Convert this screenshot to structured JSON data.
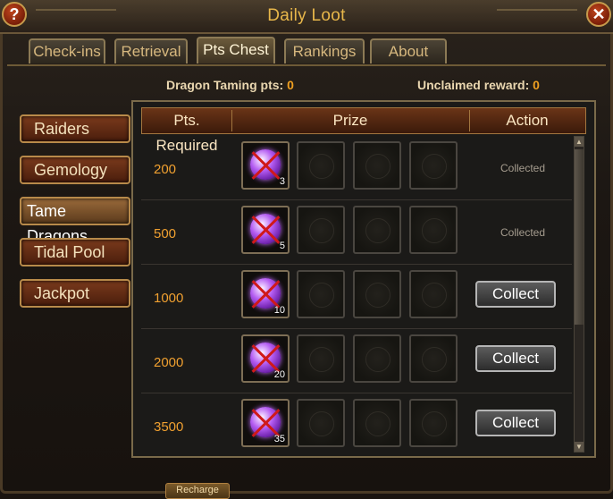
{
  "window": {
    "title": "Daily Loot"
  },
  "tabs": [
    {
      "label": "Check-ins"
    },
    {
      "label": "Retrieval"
    },
    {
      "label": "Pts Chest"
    },
    {
      "label": "Rankings"
    },
    {
      "label": "About"
    }
  ],
  "active_tab": "Pts Chest",
  "stats": {
    "pts_label": "Dragon Taming pts:",
    "pts_value": "0",
    "unclaimed_label": "Unclaimed reward:",
    "unclaimed_value": "0"
  },
  "sidebar": [
    {
      "label": "Raiders"
    },
    {
      "label": "Gemology"
    },
    {
      "label": "Tame Dragons"
    },
    {
      "label": "Tidal Pool"
    },
    {
      "label": "Jackpot"
    }
  ],
  "active_sidebar": "Tame Dragons",
  "table": {
    "headers": {
      "pts": "Pts. Required",
      "prize": "Prize",
      "action": "Action"
    },
    "rows": [
      {
        "pts": "200",
        "item_qty": "3",
        "action": "Collected"
      },
      {
        "pts": "500",
        "item_qty": "5",
        "action": "Collected"
      },
      {
        "pts": "1000",
        "item_qty": "10",
        "action": "Collect"
      },
      {
        "pts": "2000",
        "item_qty": "20",
        "action": "Collect"
      },
      {
        "pts": "3500",
        "item_qty": "35",
        "action": "Collect"
      }
    ]
  },
  "bottom": {
    "recharge_label": "Recharge"
  },
  "colors": {
    "title": "#e8b74a",
    "pts": "#f0a030",
    "highlight": "#f0a020"
  }
}
